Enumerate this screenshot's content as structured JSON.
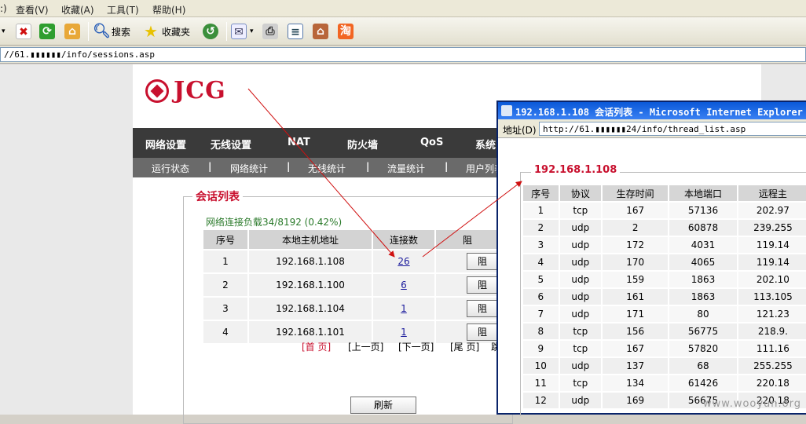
{
  "menu": [
    ":)",
    "查看(V)",
    "收藏(A)",
    "工具(T)",
    "帮助(H)"
  ],
  "toolbar": {
    "search": "搜索",
    "favorites": "收藏夹"
  },
  "address": {
    "url": "//61.▮▮▮▮▮▮/info/sessions.asp"
  },
  "logo": {
    "text": "JCG"
  },
  "nav": [
    "网络设置",
    "无线设置",
    "NAT",
    "防火墙",
    "QoS",
    "系统"
  ],
  "subnav": [
    "运行状态",
    "网络统计",
    "无线统计",
    "流量统计",
    "用户列表"
  ],
  "main": {
    "legend": "会话列表",
    "load": "网络连接负载34/8192 (0.42%)",
    "headers": [
      "序号",
      "本地主机地址",
      "连接数",
      "阻"
    ],
    "rows": [
      {
        "no": "1",
        "ip": "192.168.1.108",
        "count": "26",
        "action": "阻"
      },
      {
        "no": "2",
        "ip": "192.168.1.100",
        "count": "6",
        "action": "阻"
      },
      {
        "no": "3",
        "ip": "192.168.1.104",
        "count": "1",
        "action": "阻"
      },
      {
        "no": "4",
        "ip": "192.168.1.101",
        "count": "1",
        "action": "阻"
      }
    ],
    "pager": {
      "first": "[首 页]",
      "prev": "[上一页]",
      "next": "[下一页]",
      "last": "[尾 页]",
      "extra": "跳"
    },
    "refresh": "刷新"
  },
  "popup": {
    "title": "192.168.1.108 会话列表 - Microsoft Internet Explorer",
    "addr_label": "地址(D)",
    "url": "http://61.▮▮▮▮▮▮24/info/thread_list.asp",
    "legend": "192.168.1.108",
    "headers": [
      "序号",
      "协议",
      "生存时间",
      "本地端口",
      "远程主"
    ],
    "rows": [
      [
        "1",
        "tcp",
        "167",
        "57136",
        "202.97"
      ],
      [
        "2",
        "udp",
        "2",
        "60878",
        "239.255"
      ],
      [
        "3",
        "udp",
        "172",
        "4031",
        "119.14"
      ],
      [
        "4",
        "udp",
        "170",
        "4065",
        "119.14"
      ],
      [
        "5",
        "udp",
        "159",
        "1863",
        "202.10"
      ],
      [
        "6",
        "udp",
        "161",
        "1863",
        "113.105"
      ],
      [
        "7",
        "udp",
        "171",
        "80",
        "121.23"
      ],
      [
        "8",
        "tcp",
        "156",
        "56775",
        "218.9."
      ],
      [
        "9",
        "tcp",
        "167",
        "57820",
        "111.16"
      ],
      [
        "10",
        "udp",
        "137",
        "68",
        "255.255"
      ],
      [
        "11",
        "tcp",
        "134",
        "61426",
        "220.18"
      ],
      [
        "12",
        "udp",
        "169",
        "56675",
        "220.18"
      ]
    ]
  },
  "watermark": "www.wooyun.org",
  "colors": {
    "accent": "#c8102e",
    "nav_bg": "#3a3a3a",
    "title_bar": "#0a58d8"
  }
}
